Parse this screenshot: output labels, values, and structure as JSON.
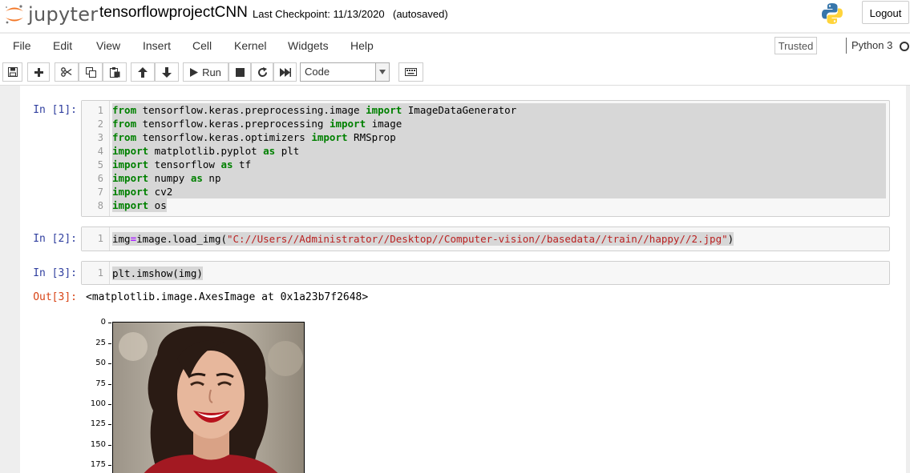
{
  "header": {
    "brand": "jupyter",
    "notebook_name": "tensorflowprojectCNN",
    "checkpoint": "Last Checkpoint: 11/13/2020",
    "autosave": "(autosaved)",
    "logout_label": "Logout"
  },
  "menubar": {
    "items": [
      "File",
      "Edit",
      "View",
      "Insert",
      "Cell",
      "Kernel",
      "Widgets",
      "Help"
    ],
    "trusted_label": "Trusted",
    "kernel_name": "Python 3"
  },
  "toolbar": {
    "run_label": "Run",
    "cell_type": "Code"
  },
  "cells": [
    {
      "prompt": "In [1]:",
      "lines": [
        "from tensorflow.keras.preprocessing.image import ImageDataGenerator",
        "from tensorflow.keras.preprocessing import image",
        "from tensorflow.keras.optimizers import RMSprop",
        "import matplotlib.pyplot as plt",
        "import tensorflow as tf",
        "import numpy as np",
        "import cv2",
        "import os"
      ]
    },
    {
      "prompt": "In [2]:",
      "lines": [
        "img=image.load_img(\"C://Users//Administrator//Desktop//Computer-vision//basedata//train//happy//2.jpg\")"
      ]
    },
    {
      "prompt": "In [3]:",
      "lines": [
        "plt.imshow(img)"
      ]
    }
  ],
  "output": {
    "prompt": "Out[3]:",
    "text": "<matplotlib.image.AxesImage at 0x1a23b7f2648>",
    "y_ticks": [
      "0",
      "25",
      "50",
      "75",
      "100",
      "125",
      "150",
      "175"
    ]
  },
  "colors": {
    "prompt_in": "#303f9f",
    "prompt_out": "#d84315",
    "keyword": "#008000",
    "string": "#ba2121",
    "jupyter_orange": "#f37726"
  }
}
